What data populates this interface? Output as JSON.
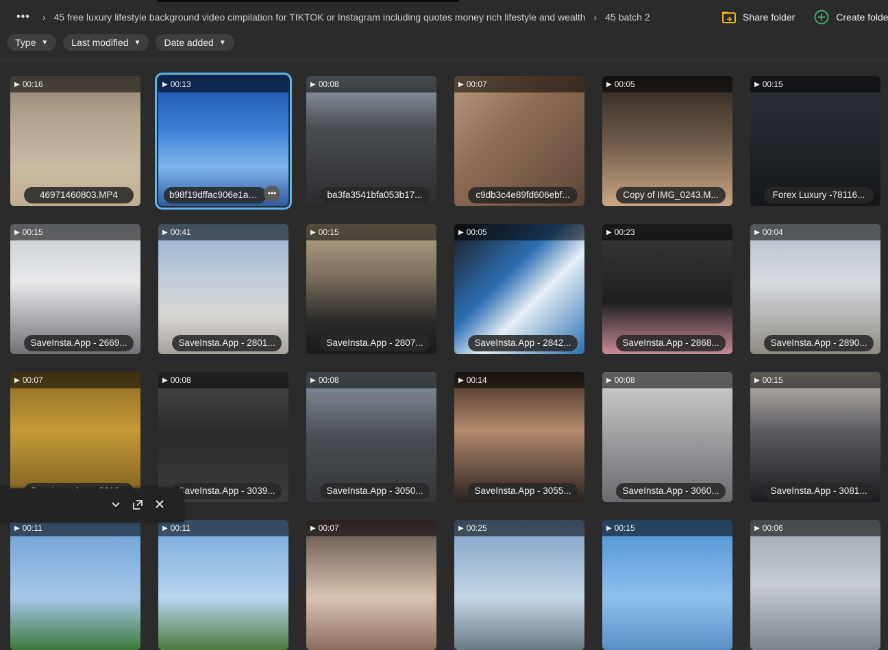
{
  "breadcrumb": {
    "more_label": "•••",
    "items": [
      "45 free luxury lifestyle background video cimpilation for TIKTOK or Instagram including quotes money rich lifestyle and wealth",
      "45 batch 2"
    ]
  },
  "actions": {
    "share_label": "Share folder",
    "create_label": "Create folder"
  },
  "filters": [
    "Type",
    "Last modified",
    "Date added"
  ],
  "tiles": [
    {
      "duration": "00:16",
      "name": "46971460803.MP4",
      "bg": "linear-gradient(180deg,#8f8372 0%,#b4a68f 35%,#c9bba2 70%,#bfae92 100%)",
      "selected": false
    },
    {
      "duration": "00:13",
      "name": "b98f19dffac906e1a5...",
      "bg": "linear-gradient(180deg,#1d4fa8 0%,#3a7fd6 40%,#7fb4ea 70%,#2f5aa0 100%)",
      "selected": true
    },
    {
      "duration": "00:08",
      "name": "ba3fa3541bfa053b17...",
      "bg": "linear-gradient(180deg,#9aa6b2 0%,#4a4d52 40%,#2b2c2f 100%)",
      "selected": false
    },
    {
      "duration": "00:07",
      "name": "c9db3c4e89fd606ebf...",
      "bg": "linear-gradient(135deg,#b79c7d 0%,#8e6d55 40%,#5d4538 100%)",
      "selected": false
    },
    {
      "duration": "00:05",
      "name": "Copy of IMG_0243.M...",
      "bg": "linear-gradient(180deg,#2a2420 0%,#6e5a48 50%,#c9a783 100%)",
      "selected": false
    },
    {
      "duration": "00:15",
      "name": "Forex Luxury -78116...",
      "bg": "linear-gradient(180deg,#2c3038 0%,#23262c 45%,#15171a 100%)",
      "selected": false
    },
    {
      "duration": "00:15",
      "name": "SaveInsta.App - 2669...",
      "bg": "linear-gradient(180deg,#c7ccd2 0%,#e7e8ea 45%,#707276 100%)",
      "selected": false
    },
    {
      "duration": "00:41",
      "name": "SaveInsta.App - 2801...",
      "bg": "linear-gradient(180deg,#8fb0d6 0%,#c0ccd8 40%,#d8d6d2 70%,#a6a29c 100%)",
      "selected": false
    },
    {
      "duration": "00:15",
      "name": "SaveInsta.App - 2807...",
      "bg": "linear-gradient(180deg,#b8a88a 0%,#7c6f5c 40%,#2a2a2a 75%,#1a1a1a 100%)",
      "selected": false
    },
    {
      "duration": "00:05",
      "name": "SaveInsta.App - 2842...",
      "bg": "linear-gradient(135deg,#1b1b1b 0%,#2d6fb4 40%,#e6eef5 60%,#2a6fb2 100%)",
      "selected": false
    },
    {
      "duration": "00:23",
      "name": "SaveInsta.App - 2868...",
      "bg": "linear-gradient(180deg,#3a3a3c 0%,#1f1f21 60%,#c98a96 100%)",
      "selected": false
    },
    {
      "duration": "00:04",
      "name": "SaveInsta.App - 2890...",
      "bg": "linear-gradient(180deg,#b4bfca 0%,#d7dbe0 45%,#8e8a82 100%)",
      "selected": false
    },
    {
      "duration": "00:07",
      "name": "SaveInsta.App - 2910...",
      "bg": "linear-gradient(180deg,#8a6a24 0%,#c59a36 45%,#7a5b22 100%)",
      "selected": false
    },
    {
      "duration": "00:08",
      "name": "SaveInsta.App - 3039...",
      "bg": "linear-gradient(180deg,#4a4a4c 0%,#2a2a2c 50%,#3c3c3e 100%)",
      "selected": false
    },
    {
      "duration": "00:08",
      "name": "SaveInsta.App - 3050...",
      "bg": "linear-gradient(180deg,#8c98a4 0%,#4a4e54 50%,#333538 100%)",
      "selected": false
    },
    {
      "duration": "00:14",
      "name": "SaveInsta.App - 3055...",
      "bg": "linear-gradient(180deg,#3a2a22 0%,#b58a6c 45%,#2a2220 100%)",
      "selected": false
    },
    {
      "duration": "00:08",
      "name": "SaveInsta.App - 3060...",
      "bg": "linear-gradient(180deg,#d2d4d6 0%,#9c9ea0 50%,#6a6c70 100%)",
      "selected": false
    },
    {
      "duration": "00:15",
      "name": "SaveInsta.App - 3081...",
      "bg": "linear-gradient(180deg,#c8bfb4 0%,#5c5c62 45%,#1c1c20 100%)",
      "selected": false
    },
    {
      "duration": "00:11",
      "name": "",
      "bg": "linear-gradient(180deg,#6a9ed6 0%,#a6c8e8 60%,#3c7a3a 100%)",
      "selected": false
    },
    {
      "duration": "00:11",
      "name": "",
      "bg": "linear-gradient(180deg,#6fa6dc 0%,#b8d6ee 60%,#4c7a3c 100%)",
      "selected": false
    },
    {
      "duration": "00:07",
      "name": "",
      "bg": "linear-gradient(180deg,#5a4a44 0%,#d9c4b0 60%,#8c6e5c 100%)",
      "selected": false
    },
    {
      "duration": "00:25",
      "name": "",
      "bg": "linear-gradient(180deg,#7aa0c6 0%,#c4d6e6 60%,#6a7a84 100%)",
      "selected": false
    },
    {
      "duration": "00:15",
      "name": "",
      "bg": "linear-gradient(180deg,#4d8ed4 0%,#8fc0ec 60%,#5a8fc4 100%)",
      "selected": false
    },
    {
      "duration": "00:06",
      "name": "",
      "bg": "linear-gradient(180deg,#9aa4ae 0%,#c6ccd2 50%,#7a828a 100%)",
      "selected": false
    }
  ],
  "minibar": {
    "chevron_icon": "chevron-down-icon",
    "expand_icon": "expand-icon",
    "close_icon": "close-icon"
  },
  "colors": {
    "background": "#2b2b2b",
    "selection": "#5ab4f0",
    "share_icon": "#f2b81c",
    "create_icon": "#3fb86f"
  }
}
